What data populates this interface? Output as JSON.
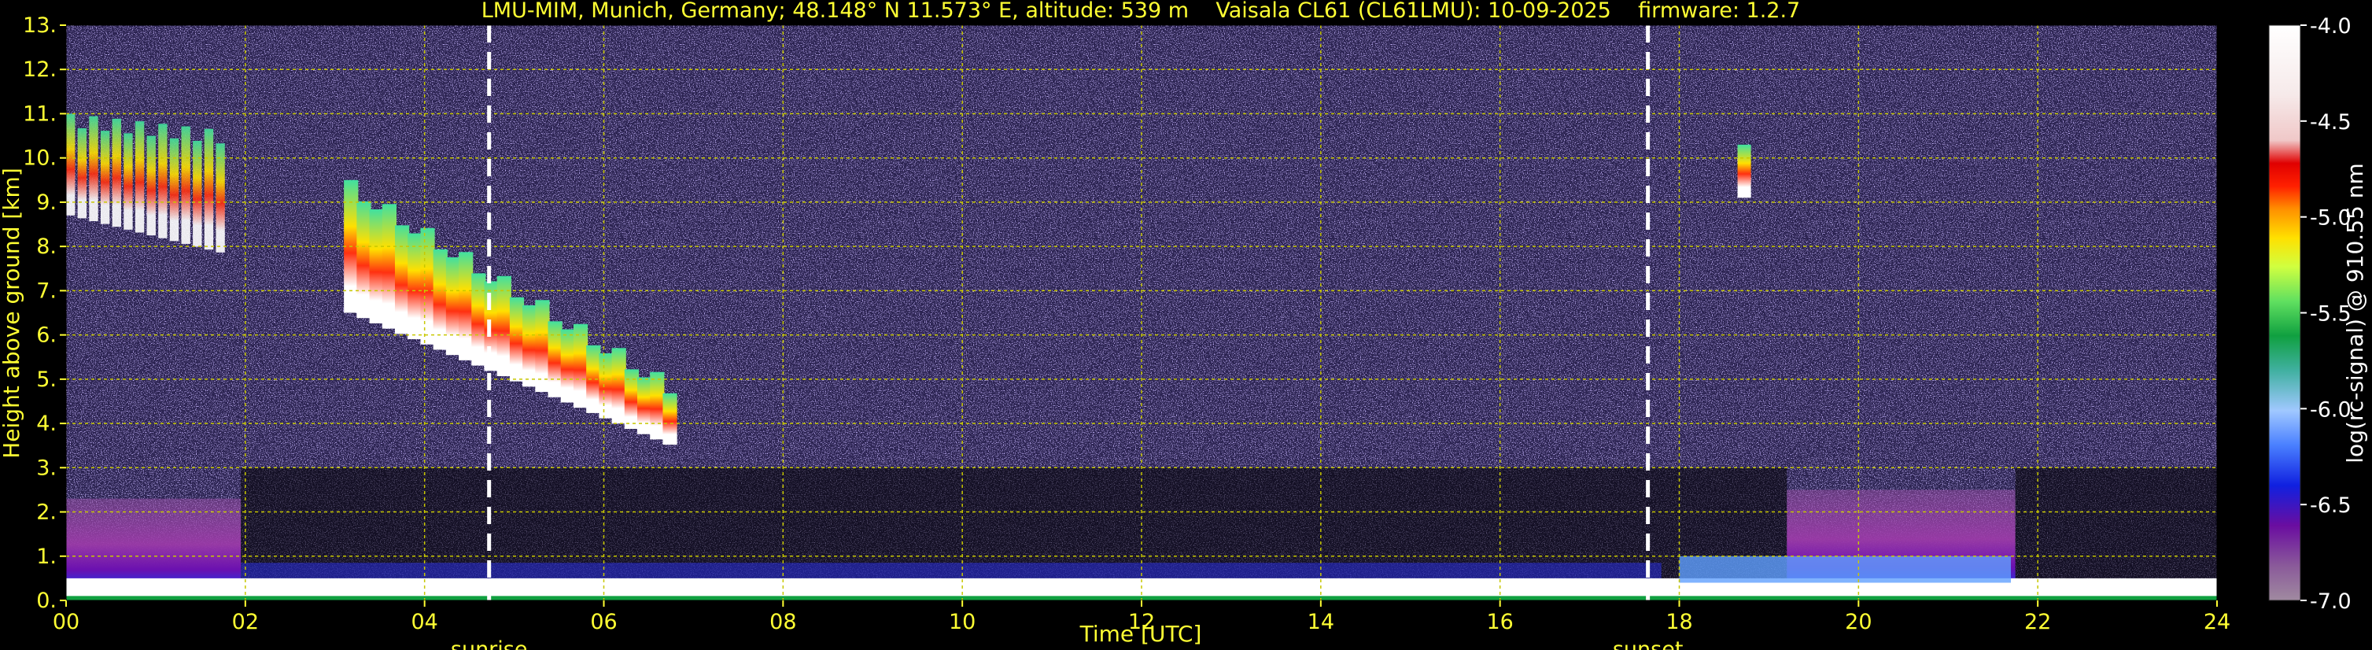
{
  "chart_data": {
    "type": "heatmap",
    "title": "LMU-MIM, Munich, Germany; 48.148° N 11.573° E, altitude: 539 m    Vaisala CL61 (CL61LMU): 10-09-2025    firmware: 1.2.7",
    "xlabel": "Time [UTC]",
    "ylabel": "Height above ground [km]",
    "colorbar_label": "log(rc-signal) @ 910.55 nm",
    "xlim": [
      0,
      24
    ],
    "ylim": [
      0,
      13
    ],
    "x_ticks": [
      "00",
      "02",
      "04",
      "06",
      "08",
      "10",
      "12",
      "14",
      "16",
      "18",
      "20",
      "22",
      "24"
    ],
    "y_ticks": [
      "0.",
      "1.",
      "2.",
      "3.",
      "4.",
      "5.",
      "6.",
      "7.",
      "8.",
      "9.",
      "10.",
      "11.",
      "12.",
      "13."
    ],
    "colorbar_ticks": [
      "-4.0",
      "-4.5",
      "-5.0",
      "-5.5",
      "-6.0",
      "-6.5",
      "-7.0"
    ],
    "colorbar_range": [
      -7.0,
      -4.0
    ],
    "grid": true,
    "annotations": [
      {
        "label": "sunrise",
        "x": 4.72
      },
      {
        "label": "sunset",
        "x": 17.65
      }
    ],
    "features": {
      "cirrus_band_1": {
        "x": [
          0.0,
          1.8
        ],
        "y": [
          7.8,
          11.0
        ],
        "value": -4.6
      },
      "descending_cloud_layer": {
        "x": [
          3.1,
          6.8
        ],
        "y_start": [
          6.5,
          9.2
        ],
        "y_end": [
          3.4,
          4.5
        ],
        "value": -4.2
      },
      "small_cloud_18h45": {
        "x": [
          18.65,
          18.8
        ],
        "y": [
          9.1,
          10.3
        ],
        "value": -4.3
      },
      "boundary_layer_night_1": {
        "x": [
          0.0,
          1.95
        ],
        "y": [
          0.0,
          2.3
        ],
        "value": -6.6
      },
      "boundary_layer_night_2": {
        "x": [
          19.2,
          21.75
        ],
        "y": [
          0.0,
          2.5
        ],
        "value": -6.6
      },
      "surface_layer": {
        "x": [
          0,
          24
        ],
        "y": [
          0.0,
          0.5
        ],
        "value": -4.2
      }
    },
    "colors": {
      "background": "#000000",
      "text": "#ffff33",
      "grid": "#c8c800",
      "sun_lines": "#ffffff",
      "noise": "#4a3d7a"
    }
  }
}
